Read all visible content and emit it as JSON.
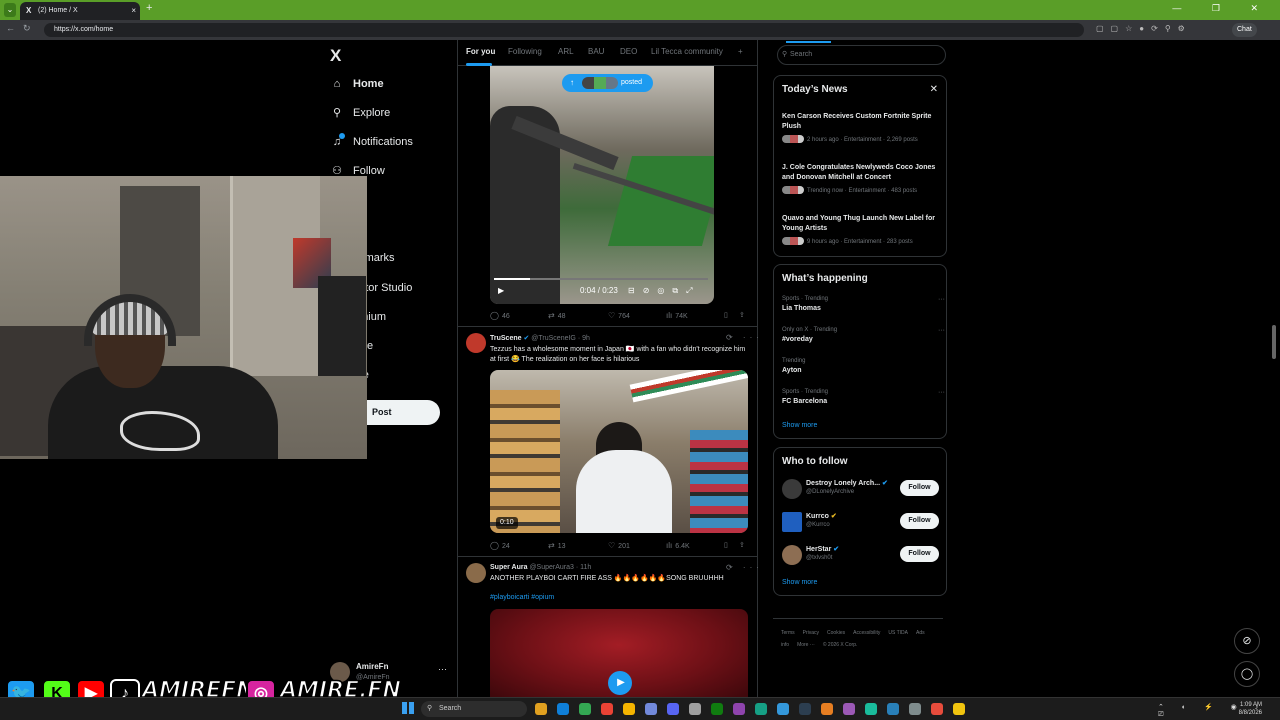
{
  "browser": {
    "tab_title": "(2) Home / X",
    "tab_favicon": "X",
    "tab_close": "×",
    "new_tab": "+",
    "url": "https://x.com/home",
    "chat_label": "Chat",
    "window_controls": "— ❐ ✕"
  },
  "sidebar_nav": {
    "logo": "X",
    "items": [
      {
        "label": "Home",
        "icon": "home-icon",
        "glyph": "⌂"
      },
      {
        "label": "Explore",
        "icon": "search-icon",
        "glyph": "⚲"
      },
      {
        "label": "Notifications",
        "icon": "bell-icon",
        "glyph": "♫"
      },
      {
        "label": "Follow",
        "icon": "follow-icon",
        "glyph": "⚇"
      },
      {
        "label": "at",
        "icon": "chat-icon",
        "glyph": "✉"
      },
      {
        "label": "ok",
        "icon": "grok-icon",
        "glyph": "◩"
      },
      {
        "label": "okmarks",
        "icon": "bookmark-icon",
        "glyph": "▯"
      },
      {
        "label": "eator Studio",
        "icon": "studio-icon",
        "glyph": "▣"
      },
      {
        "label": "emium",
        "icon": "premium-icon",
        "glyph": "✕"
      },
      {
        "label": "ofile",
        "icon": "profile-icon",
        "glyph": "☺"
      },
      {
        "label": "ore",
        "icon": "more-icon",
        "glyph": "⋯"
      }
    ],
    "post_button": "Post",
    "account": {
      "name": "AmireFn",
      "handle": "@AmireFn",
      "more": "···"
    }
  },
  "feed": {
    "tabs": [
      "For you",
      "Following",
      "ARL",
      "BAU",
      "DEO",
      "Lil Tecca community",
      "+"
    ],
    "posted_pill": "posted",
    "video1": {
      "time": "0:04 / 0:23",
      "progress": 0.17
    },
    "tweet1_actions": {
      "replies": "46",
      "reposts": "48",
      "likes": "764",
      "views": "74K"
    },
    "tweet2": {
      "name": "TruScene",
      "handle": "@TruSceneIG",
      "time": "· 9h",
      "text": "Tezzus has a wholesome moment in Japan 🇯🇵 with a fan who didn't recognize him at first 😂 The realization on her face is hilarious",
      "duration": "0:10",
      "actions": {
        "replies": "24",
        "reposts": "13",
        "likes": "201",
        "views": "6.4K"
      }
    },
    "tweet3": {
      "name": "Super Aura",
      "handle": "@SuperAura3",
      "time": "· 11h",
      "text": "ANOTHER PLAYBOI CARTI FIRE ASS 🔥🔥🔥🔥🔥🔥SONG BRUUHHH",
      "hashtags": "#playboicarti #opium"
    }
  },
  "right": {
    "search_placeholder": "Search",
    "news": {
      "title": "Today’s News",
      "close": "✕",
      "items": [
        {
          "headline": "Ken Carson Receives Custom Fortnite Sprite Plush",
          "meta": "2 hours ago · Entertainment · 2,269 posts"
        },
        {
          "headline": "J. Cole Congratulates Newlyweds Coco Jones and Donovan Mitchell at Concert",
          "meta": "Trending now · Entertainment · 483 posts"
        },
        {
          "headline": "Quavo and Young Thug Launch New Label for Young Artists",
          "meta": "9 hours ago · Entertainment · 283 posts"
        }
      ]
    },
    "happening": {
      "title": "What’s happening",
      "items": [
        {
          "category": "Sports · Trending",
          "name": "Lia Thomas"
        },
        {
          "category": "Only on X · Trending",
          "name": "#voreday"
        },
        {
          "category": "Trending",
          "name": "Ayton"
        },
        {
          "category": "Sports · Trending",
          "name": "FC Barcelona"
        }
      ],
      "show_more": "Show more"
    },
    "who_to_follow": {
      "title": "Who to follow",
      "items": [
        {
          "name": "Destroy Lonely Arch...",
          "handle": "@DLonelyArchive",
          "badge": "✔",
          "button": "Follow"
        },
        {
          "name": "Kurrco",
          "handle": "@Kurrco",
          "badge": "✔",
          "button": "Follow"
        },
        {
          "name": "HerStar",
          "handle": "@txlvsh0t",
          "badge": "✔",
          "button": "Follow"
        }
      ],
      "show_more": "Show more"
    },
    "footer": [
      "Terms",
      "Privacy",
      "Cookies",
      "Accessibility",
      "US TIDA",
      "Ads info",
      "More ···",
      "© 2026 X Corp."
    ]
  },
  "overlay": {
    "handle1": "AMIREFN",
    "handle2": "AMIRE.FN",
    "social_icons": [
      "twitter-icon",
      "kick-icon",
      "youtube-icon",
      "tiktok-icon",
      "instagram-icon"
    ]
  },
  "taskbar": {
    "search": "Search",
    "time": "1:09 AM",
    "date": "8/8/2026"
  },
  "colors": {
    "accent": "#1d9bf0",
    "tab_bar": "#5a9e28",
    "background": "#000000"
  }
}
